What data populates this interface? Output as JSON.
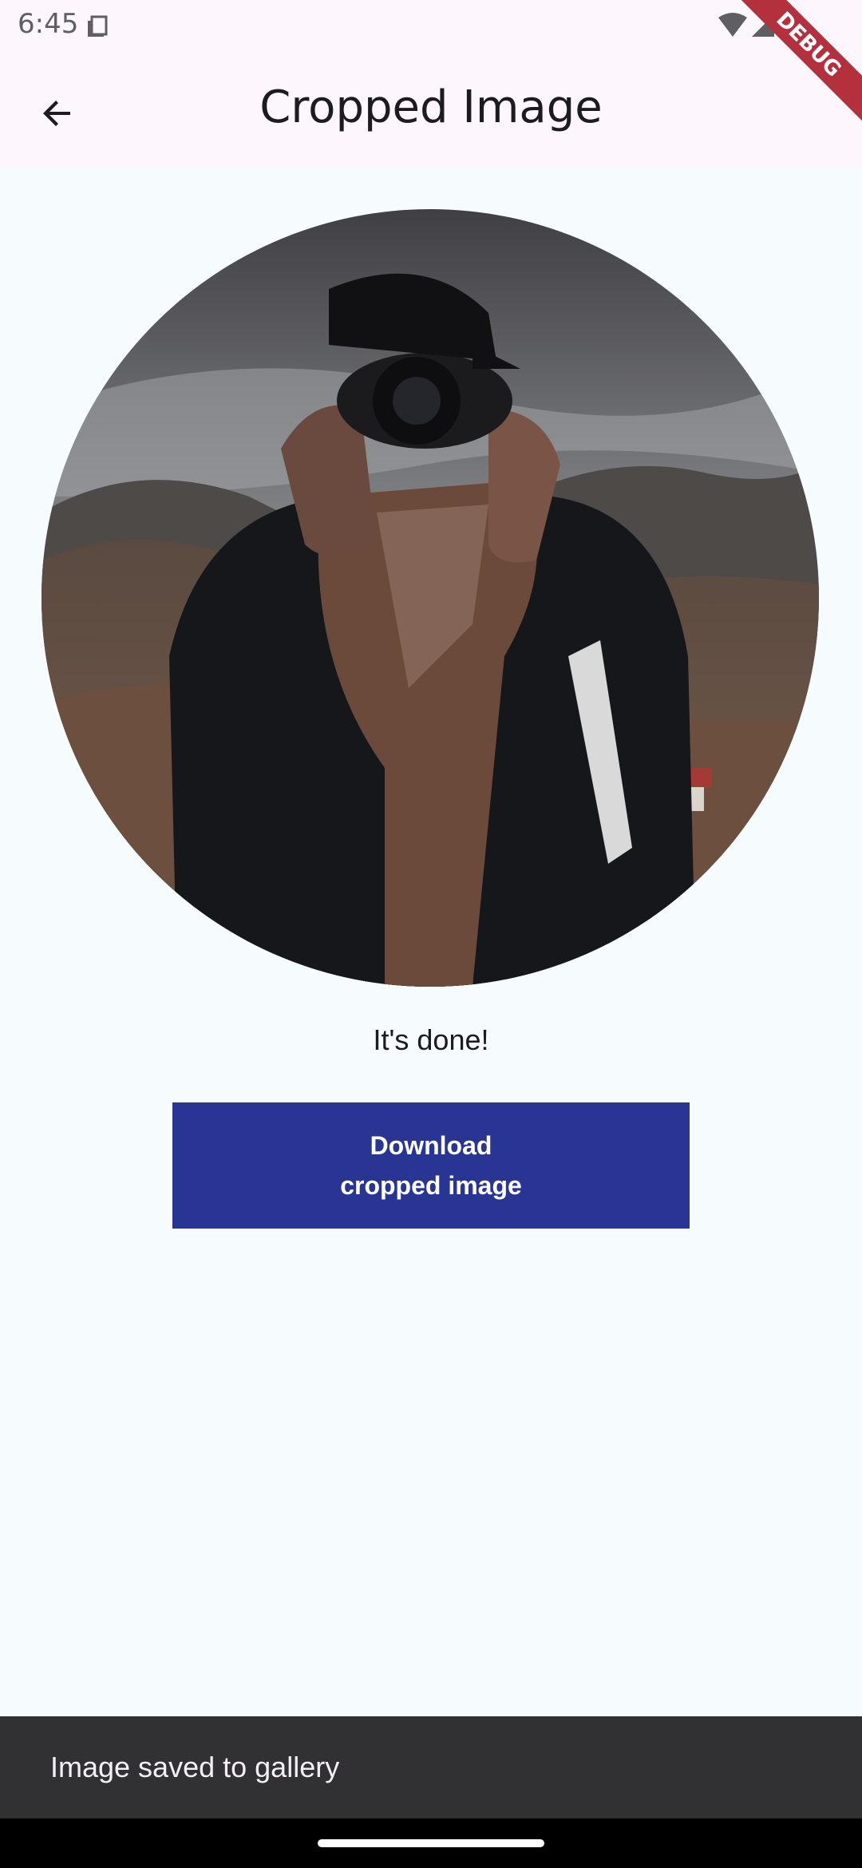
{
  "status_bar": {
    "time": "6:45",
    "icons": [
      "sim-card-icon",
      "wifi-icon",
      "cell-signal-icon",
      "battery-icon"
    ]
  },
  "debug_banner": {
    "label": "DEBUG"
  },
  "app_bar": {
    "title": "Cropped Image",
    "back_icon": "arrow-back-icon"
  },
  "content": {
    "image_shape": "circle",
    "image_subject": "photo of a person in cap and scarf holding a camera in front of mountains",
    "status_text": "It's done!",
    "download_button": {
      "line1": "Download",
      "line2": "cropped image",
      "color": "#283593"
    }
  },
  "snackbar": {
    "message": "Image saved to gallery"
  },
  "colors": {
    "app_bar_bg": "#fdf6fc",
    "page_bg": "#f6fbfd",
    "button_bg": "#283593",
    "snackbar_bg": "#313033"
  }
}
